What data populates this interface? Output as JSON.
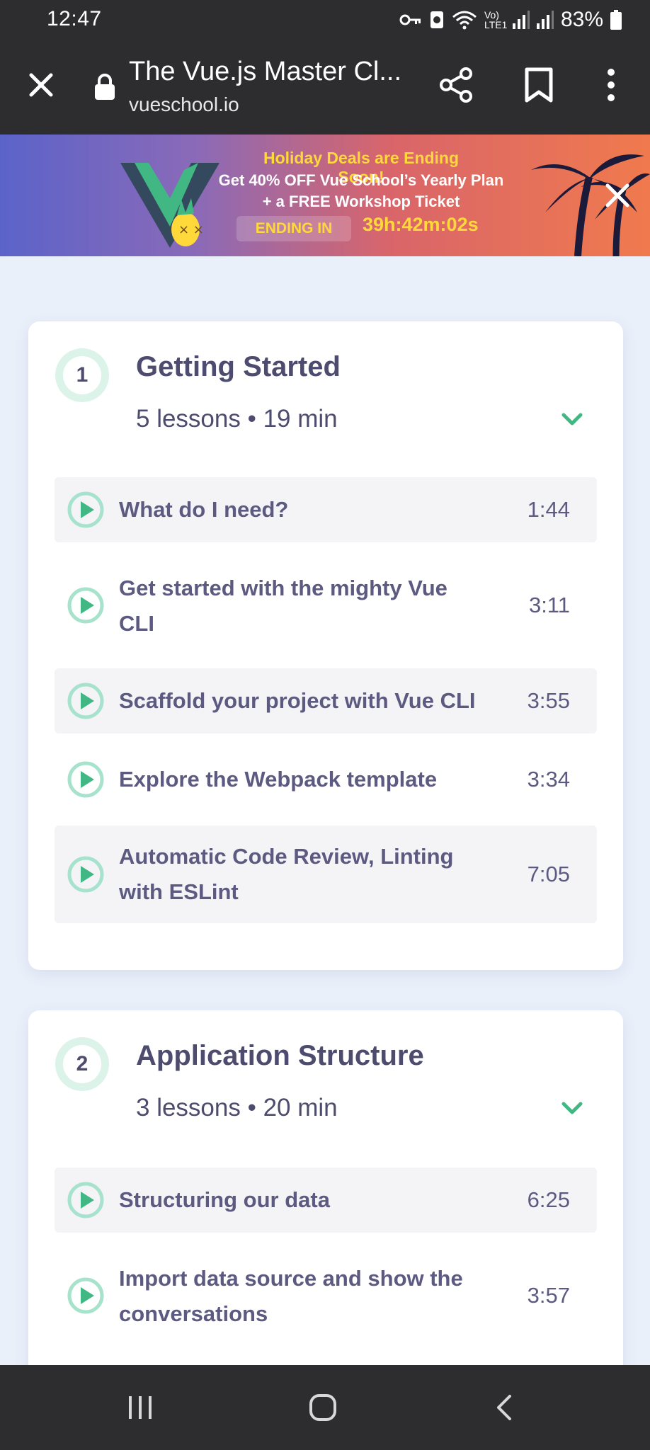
{
  "status_bar": {
    "time": "12:47",
    "network_label": "Vo) LTE1",
    "battery_percent": "83%"
  },
  "browser": {
    "page_title": "The Vue.js Master Cl...",
    "url": "vueschool.io"
  },
  "banner": {
    "headline": "Holiday Deals are Ending Soon!",
    "line2": "Get 40% OFF Vue School’s Yearly Plan",
    "line3": "+ a FREE Workshop Ticket",
    "ending_label": "ENDING IN",
    "countdown": "39h:42m:02s",
    "colors": {
      "accent_yellow": "#ffd93a",
      "gradient_start": "#5b63c9",
      "gradient_end": "#f07a4d"
    }
  },
  "chapters": [
    {
      "number": "1",
      "title": "Getting Started",
      "meta": "5 lessons • 19 min",
      "lessons": [
        {
          "title": "What do I need?",
          "duration": "1:44"
        },
        {
          "title": "Get started with the mighty Vue CLI",
          "duration": "3:11"
        },
        {
          "title": "Scaffold your project with Vue CLI",
          "duration": "3:55"
        },
        {
          "title": "Explore the Webpack template",
          "duration": "3:34"
        },
        {
          "title": "Automatic Code Review, Linting with ESLint",
          "duration": "7:05"
        }
      ]
    },
    {
      "number": "2",
      "title": "Application Structure",
      "meta": "3 lessons • 20 min",
      "lessons": [
        {
          "title": "Structuring our data",
          "duration": "6:25"
        },
        {
          "title": "Import data source and show the conversations",
          "duration": "3:57"
        }
      ]
    }
  ],
  "theme": {
    "accent_green": "#41b883",
    "text_purple": "#4d4b6e",
    "row_shade": "#f4f4f7",
    "page_bg": "#eaf0fa"
  },
  "icons": {
    "close": "close-icon",
    "lock": "lock-icon",
    "share": "share-icon",
    "bookmark": "bookmark-icon",
    "more": "more-vert-icon",
    "play": "play-circle-icon",
    "chevron": "chevron-down-icon"
  }
}
